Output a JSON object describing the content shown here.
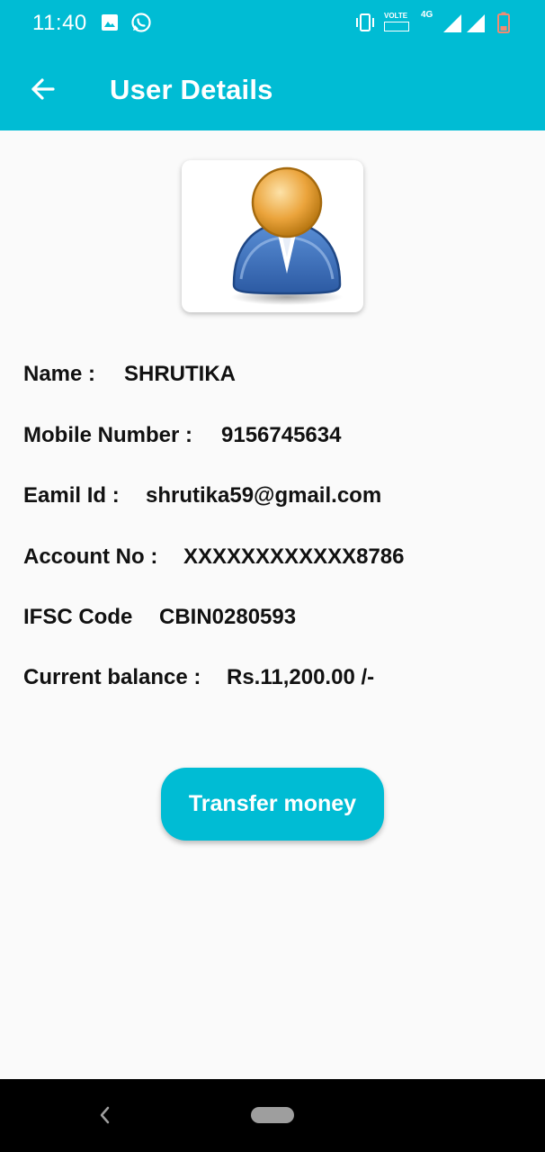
{
  "status_bar": {
    "time": "11:40",
    "network_label": "4G",
    "volte_label": "VOLTE",
    "icons": [
      "image-icon",
      "whatsapp-icon",
      "vibrate-icon",
      "volte-icon",
      "signal-icon",
      "signal-icon",
      "battery-icon"
    ]
  },
  "app_bar": {
    "title": "User Details",
    "back_icon": "arrow-left-icon"
  },
  "user": {
    "name_label": "Name :",
    "name_value": "SHRUTIKA",
    "mobile_label": "Mobile Number :",
    "mobile_value": "9156745634",
    "email_label": "Eamil Id :",
    "email_value": "shrutika59@gmail.com",
    "account_label": "Account No :",
    "account_value": "XXXXXXXXXXXX8786",
    "ifsc_label": "IFSC Code",
    "ifsc_value": "CBIN0280593",
    "balance_label": "Current balance :",
    "balance_value": "Rs.11,200.00 /-"
  },
  "actions": {
    "transfer_label": "Transfer money"
  },
  "colors": {
    "primary": "#00bcd4",
    "background": "#fafafa",
    "text": "#111111",
    "nav_bar": "#000000"
  }
}
